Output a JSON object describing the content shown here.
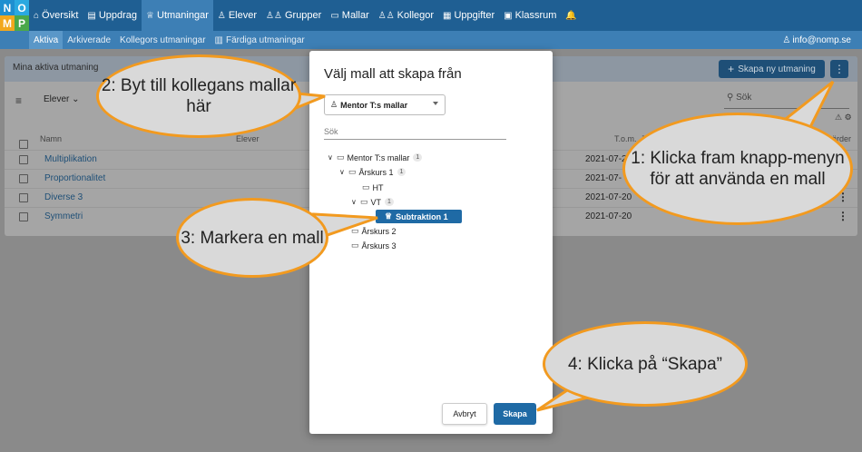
{
  "logo": {
    "letters": [
      "N",
      "O",
      "M",
      "P"
    ]
  },
  "nav": {
    "items": [
      {
        "icon": "⌂",
        "label": "Översikt"
      },
      {
        "icon": "▤",
        "label": "Uppdrag"
      },
      {
        "icon": "♕",
        "label": "Utmaningar",
        "active": true
      },
      {
        "icon": "♙",
        "label": "Elever"
      },
      {
        "icon": "♙♙",
        "label": "Grupper"
      },
      {
        "icon": "▭",
        "label": "Mallar"
      },
      {
        "icon": "♙♙",
        "label": "Kollegor"
      },
      {
        "icon": "▦",
        "label": "Uppgifter"
      },
      {
        "icon": "▣",
        "label": "Klassrum"
      },
      {
        "icon": "🔔",
        "label": ""
      }
    ]
  },
  "subnav": {
    "items": [
      {
        "label": "Aktiva",
        "active": true
      },
      {
        "label": "Arkiverade"
      },
      {
        "label": "Kollegors utmaningar"
      },
      {
        "label": "Färdiga utmaningar"
      }
    ],
    "user_email": "info@nomp.se"
  },
  "card": {
    "title": "Mina aktiva utmaning",
    "create_label": "Skapa ny utmaning",
    "filter_label": "Elever",
    "search_placeholder": "Sök",
    "columns": {
      "name": "Namn",
      "students": "Elever",
      "end": "T.o.m.",
      "j": "J",
      "values": "ärder"
    },
    "rows": [
      {
        "name": "Multiplikation",
        "date": "2021-07-2"
      },
      {
        "name": "Proportionalitet",
        "date": "2021-07-"
      },
      {
        "name": "Diverse 3",
        "date": "2021-07-20"
      },
      {
        "name": "Symmetri",
        "date": "2021-07-20"
      }
    ]
  },
  "dialog": {
    "title": "Välj mall att skapa från",
    "select_value": "Mentor T:s mallar",
    "search_placeholder": "Sök",
    "tree": {
      "root": {
        "label": "Mentor T:s mallar",
        "count": "1"
      },
      "ak1": {
        "label": "Årskurs 1",
        "count": "1"
      },
      "ht": {
        "label": "HT"
      },
      "vt": {
        "label": "VT",
        "count": "1"
      },
      "selected": {
        "label": "Subtraktion 1"
      },
      "ak2": {
        "label": "Årskurs 2"
      },
      "ak3": {
        "label": "Årskurs 3"
      }
    },
    "cancel_label": "Avbryt",
    "create_label": "Skapa"
  },
  "callouts": {
    "c1": "1: Klicka fram knapp-menyn för att använda en mall",
    "c2": "2: Byt till kollegans mallar här",
    "c3": "3: Markera en mall",
    "c4": "4: Klicka på “Skapa”"
  },
  "colors": {
    "nav": "#1f5f93",
    "primary": "#1f6aa5",
    "callout_border": "#f29a1f"
  }
}
